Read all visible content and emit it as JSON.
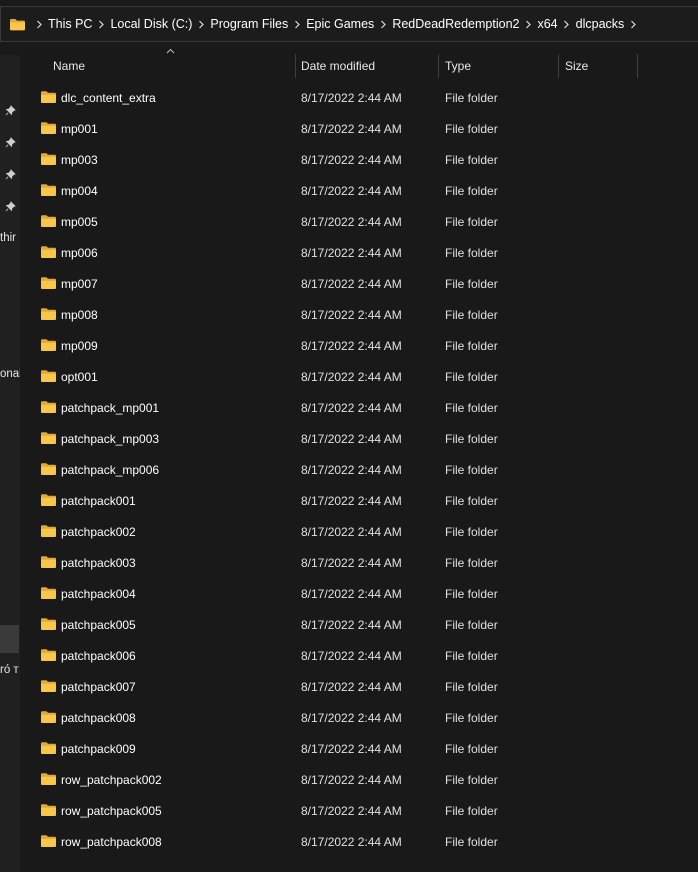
{
  "address_bar": {
    "crumbs": [
      "This PC",
      "Local Disk (C:)",
      "Program Files",
      "Epic Games",
      "RedDeadRedemption2",
      "x64",
      "dlcpacks"
    ]
  },
  "nav_pane": {
    "fragments": [
      "thir",
      "onal",
      "ró т"
    ]
  },
  "columns": {
    "name": "Name",
    "date_modified": "Date modified",
    "type": "Type",
    "size": "Size"
  },
  "files": [
    {
      "name": "dlc_content_extra",
      "date": "8/17/2022 2:44 AM",
      "type": "File folder"
    },
    {
      "name": "mp001",
      "date": "8/17/2022 2:44 AM",
      "type": "File folder"
    },
    {
      "name": "mp003",
      "date": "8/17/2022 2:44 AM",
      "type": "File folder"
    },
    {
      "name": "mp004",
      "date": "8/17/2022 2:44 AM",
      "type": "File folder"
    },
    {
      "name": "mp005",
      "date": "8/17/2022 2:44 AM",
      "type": "File folder"
    },
    {
      "name": "mp006",
      "date": "8/17/2022 2:44 AM",
      "type": "File folder"
    },
    {
      "name": "mp007",
      "date": "8/17/2022 2:44 AM",
      "type": "File folder"
    },
    {
      "name": "mp008",
      "date": "8/17/2022 2:44 AM",
      "type": "File folder"
    },
    {
      "name": "mp009",
      "date": "8/17/2022 2:44 AM",
      "type": "File folder"
    },
    {
      "name": "opt001",
      "date": "8/17/2022 2:44 AM",
      "type": "File folder"
    },
    {
      "name": "patchpack_mp001",
      "date": "8/17/2022 2:44 AM",
      "type": "File folder"
    },
    {
      "name": "patchpack_mp003",
      "date": "8/17/2022 2:44 AM",
      "type": "File folder"
    },
    {
      "name": "patchpack_mp006",
      "date": "8/17/2022 2:44 AM",
      "type": "File folder"
    },
    {
      "name": "patchpack001",
      "date": "8/17/2022 2:44 AM",
      "type": "File folder"
    },
    {
      "name": "patchpack002",
      "date": "8/17/2022 2:44 AM",
      "type": "File folder"
    },
    {
      "name": "patchpack003",
      "date": "8/17/2022 2:44 AM",
      "type": "File folder"
    },
    {
      "name": "patchpack004",
      "date": "8/17/2022 2:44 AM",
      "type": "File folder"
    },
    {
      "name": "patchpack005",
      "date": "8/17/2022 2:44 AM",
      "type": "File folder"
    },
    {
      "name": "patchpack006",
      "date": "8/17/2022 2:44 AM",
      "type": "File folder"
    },
    {
      "name": "patchpack007",
      "date": "8/17/2022 2:44 AM",
      "type": "File folder"
    },
    {
      "name": "patchpack008",
      "date": "8/17/2022 2:44 AM",
      "type": "File folder"
    },
    {
      "name": "patchpack009",
      "date": "8/17/2022 2:44 AM",
      "type": "File folder"
    },
    {
      "name": "row_patchpack002",
      "date": "8/17/2022 2:44 AM",
      "type": "File folder"
    },
    {
      "name": "row_patchpack005",
      "date": "8/17/2022 2:44 AM",
      "type": "File folder"
    },
    {
      "name": "row_patchpack008",
      "date": "8/17/2022 2:44 AM",
      "type": "File folder"
    }
  ],
  "icons": {
    "folder": "folder-icon",
    "pin": "pin-icon",
    "chevron": "chevron-right-icon",
    "sort": "sort-ascending-icon"
  },
  "colors": {
    "background": "#191919",
    "folder_yellow": "#f8c64a",
    "text": "#ffffff"
  }
}
